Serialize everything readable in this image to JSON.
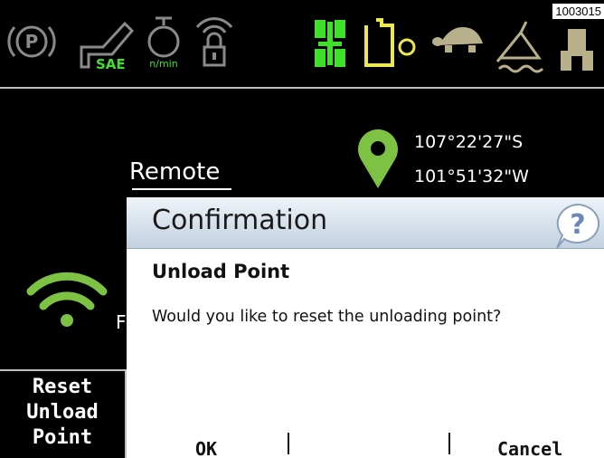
{
  "reference_id": "1003015",
  "status_bar": {
    "icons": [
      {
        "name": "parking-brake-icon",
        "text": "P"
      },
      {
        "name": "hitch-sae-icon",
        "text": "SAE"
      },
      {
        "name": "engine-rpm-icon",
        "text": "n/min"
      },
      {
        "name": "remote-lock-icon"
      },
      {
        "name": "four-wheel-drive-icon"
      },
      {
        "name": "hydraulic-tank-icon"
      },
      {
        "name": "turtle-speed-icon"
      },
      {
        "name": "implement-icon"
      },
      {
        "name": "tractor-icon"
      }
    ],
    "colors": {
      "gray": "#8a8a8a",
      "green": "#3ee02a",
      "yellow": "#eaea50",
      "olive": "#b8b08a"
    }
  },
  "main": {
    "remote_label": "Remote",
    "gps": {
      "latitude": "107°22'27\"S",
      "longitude": "101°51'32\"W",
      "pin_color": "#7dc242"
    },
    "wifi_color": "#7dc242",
    "partial_label": "F"
  },
  "softkey": {
    "line1": "Reset",
    "line2": "Unload",
    "line3": "Point"
  },
  "dialog": {
    "title": "Confirmation",
    "heading": "Unload Point",
    "message": "Would you like to reset the unloading point?",
    "ok_label": "OK",
    "cancel_label": "Cancel"
  }
}
